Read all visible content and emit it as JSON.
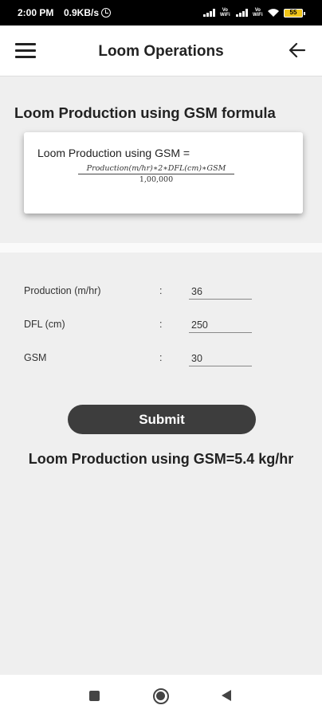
{
  "status_bar": {
    "time": "2:00 PM",
    "speed": "0.9KB/s",
    "volte_labels": [
      "Vo\nWiFi",
      "Vo\nWiFi"
    ],
    "battery": "55",
    "icons": [
      "alarm-icon",
      "signal-icon",
      "signal-icon",
      "wifi-icon",
      "battery-icon"
    ]
  },
  "app_bar": {
    "title": "Loom Operations",
    "left_icon": "menu-icon",
    "right_icon": "back-arrow-icon"
  },
  "formula": {
    "section_title": "Loom Production using GSM formula",
    "label": "Loom Production using GSM =",
    "numerator": "Production(m/hr)∗2∗DFL(cm)∗GSM",
    "denominator": "1,00,000"
  },
  "fields": [
    {
      "label": "Production (m/hr)",
      "colon": ":",
      "value": "36"
    },
    {
      "label": "DFL (cm)",
      "colon": ":",
      "value": "250"
    },
    {
      "label": "GSM",
      "colon": ":",
      "value": "30"
    }
  ],
  "submit_label": "Submit",
  "result": "Loom Production using GSM=5.4 kg/hr",
  "nav_bar": {
    "icons": [
      "recent-apps-icon",
      "home-icon",
      "back-icon"
    ]
  },
  "colors": {
    "background": "#efefef",
    "button": "#3d3d3d",
    "battery": "#f0c419"
  }
}
